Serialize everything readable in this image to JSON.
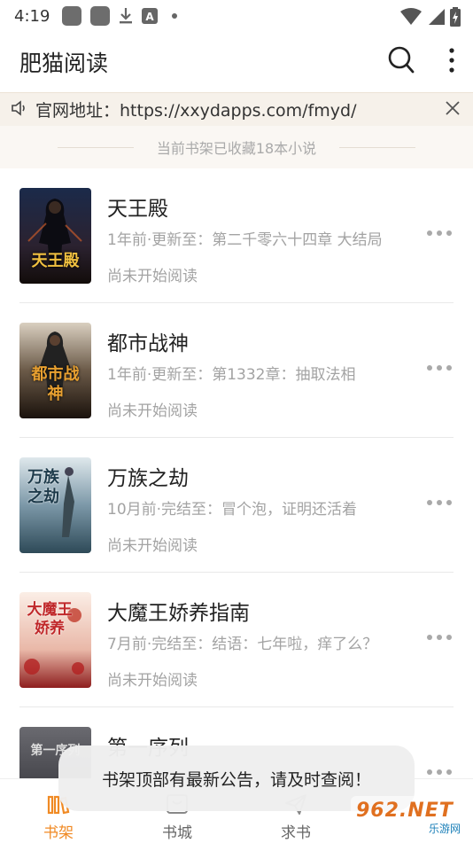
{
  "status_bar": {
    "time": "4:19"
  },
  "app_bar": {
    "title": "肥猫阅读"
  },
  "notice": {
    "text": "官网地址：https://xxydapps.com/fmyd/"
  },
  "shelf": {
    "count_text": "当前书架已收藏18本小说"
  },
  "books": [
    {
      "title": "天王殿",
      "update": "1年前·更新至：第二千零六十四章 大结局",
      "progress": "尚未开始阅读",
      "cover_text": "天王殿"
    },
    {
      "title": "都市战神",
      "update": "1年前·更新至：第1332章：抽取法相",
      "progress": "尚未开始阅读",
      "cover_text": "都市战神"
    },
    {
      "title": "万族之劫",
      "update": "10月前·完结至：冒个泡，证明还活着",
      "progress": "尚未开始阅读",
      "cover_text": "万族之劫"
    },
    {
      "title": "大魔王娇养指南",
      "update": "7月前·完结至：结语：七年啦，痒了么？",
      "progress": "尚未开始阅读",
      "cover_text": "大魔王娇养"
    },
    {
      "title": "第一序列",
      "update": "",
      "progress": "",
      "cover_text": "第一序列"
    }
  ],
  "toast": {
    "text": "书架顶部有最新公告，请及时查阅！"
  },
  "bottom_nav": [
    {
      "label": "书架",
      "active": true
    },
    {
      "label": "书城",
      "active": false
    },
    {
      "label": "求书",
      "active": false
    }
  ],
  "watermark": {
    "text": "962.NET",
    "subtext": "乐游网"
  },
  "colors": {
    "accent": "#f08a24",
    "notice_bg": "#f6f1ea"
  }
}
